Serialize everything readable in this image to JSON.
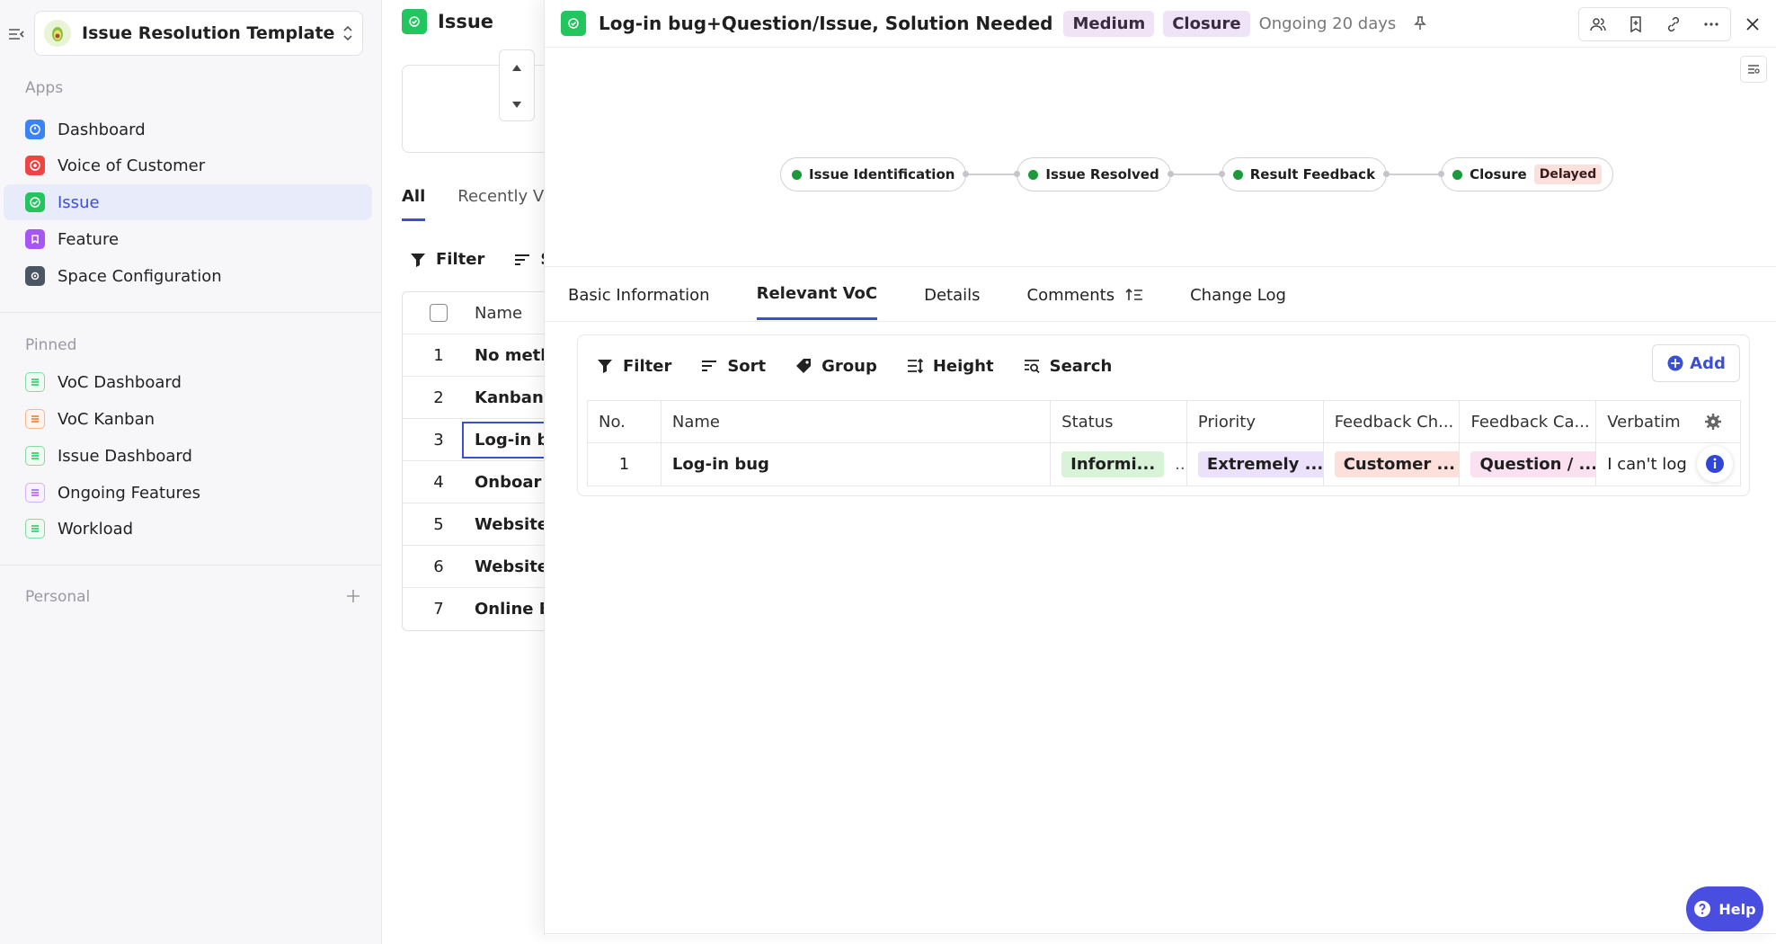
{
  "sidebar": {
    "space_name": "Issue Resolution Template",
    "apps_label": "Apps",
    "apps": [
      {
        "label": "Dashboard",
        "color": "#3b82f6"
      },
      {
        "label": "Voice of Customer",
        "color": "#ef4444"
      },
      {
        "label": "Issue",
        "color": "#22c55e"
      },
      {
        "label": "Feature",
        "color": "#a855f7"
      },
      {
        "label": "Space Configuration",
        "color": "#4b5563"
      }
    ],
    "pinned_label": "Pinned",
    "pinned": [
      {
        "label": "VoC Dashboard",
        "color": "#22c55e"
      },
      {
        "label": "VoC Kanban",
        "color": "#f97316"
      },
      {
        "label": "Issue Dashboard",
        "color": "#22c55e"
      },
      {
        "label": "Ongoing Features",
        "color": "#a855f7"
      },
      {
        "label": "Workload",
        "color": "#22c55e"
      }
    ],
    "personal_label": "Personal"
  },
  "list_panel": {
    "title": "Issue",
    "tabs": [
      "All",
      "Recently Vi"
    ],
    "filter_label": "Filter",
    "sort_label": "S",
    "column_name": "Name",
    "rows": [
      {
        "num": "1",
        "name": "No meth"
      },
      {
        "num": "2",
        "name": "Kanban"
      },
      {
        "num": "3",
        "name": "Log-in b"
      },
      {
        "num": "4",
        "name": "Onboar"
      },
      {
        "num": "5",
        "name": "Website"
      },
      {
        "num": "6",
        "name": "Website"
      },
      {
        "num": "7",
        "name": "Online E"
      }
    ]
  },
  "detail": {
    "title": "Log-in bug+Question/Issue, Solution Needed",
    "priority_badge": "Medium",
    "stage_badge": "Closure",
    "ongoing": "Ongoing 20 days",
    "workflow": [
      {
        "label": "Issue Identification"
      },
      {
        "label": "Issue Resolved"
      },
      {
        "label": "Result Feedback"
      },
      {
        "label": "Closure",
        "flag": "Delayed"
      }
    ],
    "tabs": [
      "Basic Information",
      "Relevant VoC",
      "Details",
      "Comments",
      "Change Log"
    ],
    "active_tab": "Relevant VoC",
    "toolbar": {
      "filter": "Filter",
      "sort": "Sort",
      "group": "Group",
      "height": "Height",
      "search": "Search",
      "add": "Add"
    },
    "table": {
      "columns": [
        "No.",
        "Name",
        "Status",
        "Priority",
        "Feedback Ch...",
        "Feedback Ca...",
        "Verbatim"
      ],
      "rows": [
        {
          "no": "1",
          "name": "Log-in bug",
          "status": "Informi...",
          "status_more": "...",
          "priority": "Extremely ...",
          "feedback_channel": "Customer ...",
          "feedback_category": "Question / ...",
          "verbatim": "I can't log"
        }
      ]
    }
  },
  "help_label": "Help",
  "colors": {
    "accent": "#3b4fd6",
    "issue_green": "#22c55e",
    "workflow_dot": "#1c9a3a"
  }
}
